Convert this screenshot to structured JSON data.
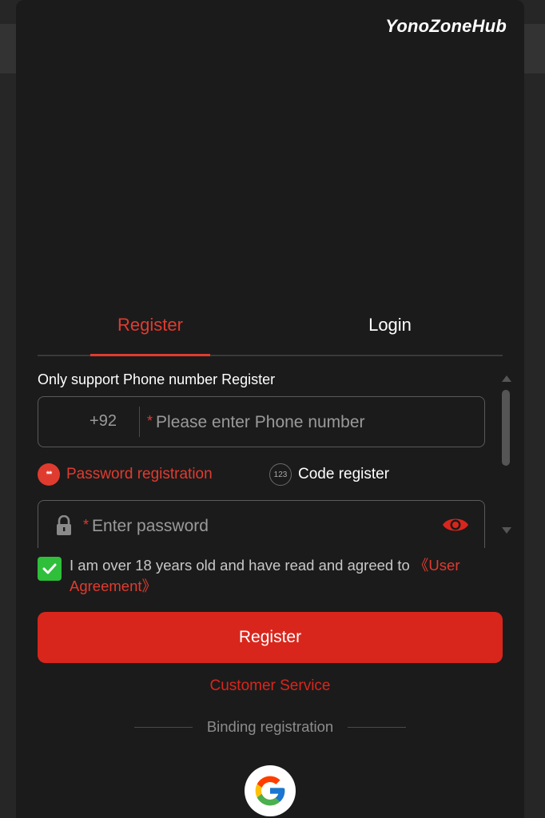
{
  "watermark": "YonoZoneHub",
  "tabs": {
    "register": "Register",
    "login": "Login"
  },
  "hint": "Only support Phone number Register",
  "phone": {
    "country_code": "+92",
    "required_mark": "*",
    "placeholder": "Please enter Phone number",
    "value": ""
  },
  "modes": {
    "password_badge": "**",
    "password_label": "Password registration",
    "code_badge": "123",
    "code_label": "Code register"
  },
  "password": {
    "required_mark": "*",
    "placeholder": "Enter password",
    "value": ""
  },
  "agreement": {
    "checked": true,
    "text": "I am over 18 years old and have read and agreed to ",
    "link": "《User Agreement》"
  },
  "register_button": "Register",
  "customer_service": "Customer Service",
  "binding_label": "Binding registration",
  "colors": {
    "accent": "#d9261c",
    "checkbox": "#2fbf3b",
    "panel": "#1b1b1b"
  },
  "icons": [
    "lock-icon",
    "eye-icon",
    "google-icon",
    "check-icon"
  ]
}
